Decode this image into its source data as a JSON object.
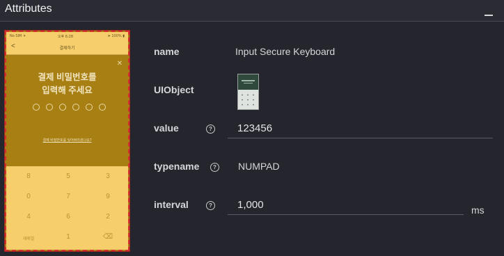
{
  "panel": {
    "title": "Attributes"
  },
  "phone": {
    "status_left": "No SIM ✈",
    "status_center": "오후 6:28",
    "status_right": "➤ 100% ▮",
    "nav_back": "<",
    "nav_title": "결제하기",
    "close": "✕",
    "prompt_line1": "결제 비밀번호를",
    "prompt_line2": "입력해 주세요",
    "pin_length": 6,
    "forgot_link": "결제 비밀번호를 잊어버리셨나요?",
    "keys": [
      "8",
      "5",
      "3",
      "0",
      "7",
      "9",
      "4",
      "6",
      "2",
      "재배열",
      "1",
      "⌫"
    ]
  },
  "attributes": {
    "name": {
      "label": "name",
      "value": "Input Secure Keyboard"
    },
    "uiobject": {
      "label": "UIObject"
    },
    "value": {
      "label": "value",
      "value": "123456"
    },
    "typename": {
      "label": "typename",
      "value": "NUMPAD"
    },
    "interval": {
      "label": "interval",
      "value": "1,000",
      "unit": "ms"
    },
    "help_glyph": "?"
  }
}
